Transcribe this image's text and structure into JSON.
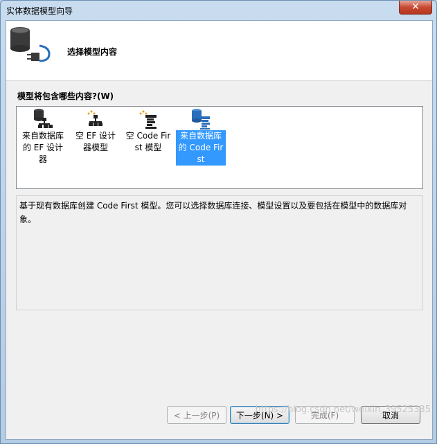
{
  "window": {
    "title": "实体数据模型向导",
    "close_glyph": "✕"
  },
  "header": {
    "title": "选择模型内容",
    "icon": "database-plug-icon"
  },
  "section": {
    "label": "模型将包含哪些内容?(W)"
  },
  "options": [
    {
      "label": "来自数据库的 EF 设计器",
      "icon": "database-designer-icon",
      "selected": false
    },
    {
      "label": "空 EF 设计器模型",
      "icon": "empty-designer-icon",
      "selected": false
    },
    {
      "label": "空 Code First 模型",
      "icon": "empty-code-first-icon",
      "selected": false
    },
    {
      "label": "来自数据库的 Code First",
      "icon": "database-code-first-icon",
      "selected": true
    }
  ],
  "description": "基于现有数据库创建 Code First 模型。您可以选择数据库连接、模型设置以及要包括在模型中的数据库对象。",
  "buttons": {
    "back": "< 上一步(P)",
    "next": "下一步(N) >",
    "finish": "完成(F)",
    "cancel": "取消"
  },
  "watermark": "https://blog.csdn.net/weixin_39525335",
  "colors": {
    "selection": "#3399ff",
    "accent_blue": "#2a6ebb"
  }
}
